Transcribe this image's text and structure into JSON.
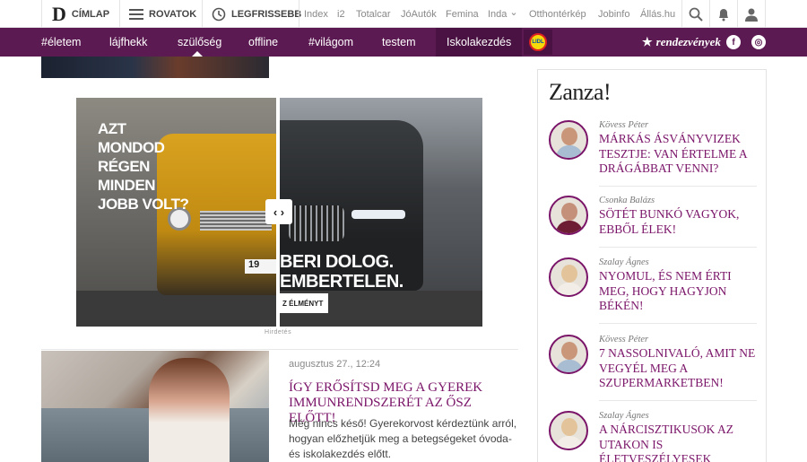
{
  "topnav": {
    "logo": "D",
    "home_label": "CÍMLAP",
    "sections_label": "ROVATOK",
    "latest_label": "LEGFRISSEBB",
    "links": [
      "Index",
      "i2",
      "Totalcar",
      "JóAutók",
      "Femina",
      "Inda",
      "Otthontérkép",
      "Jobinfo",
      "Állás.hu"
    ],
    "inda_chevron": "⌄"
  },
  "catbar": {
    "categories": [
      "#életem",
      "lájfhekk",
      "szülőség",
      "offline",
      "#világom",
      "testem",
      "Iskolakezdés"
    ],
    "sponsor_logo": "LIDL",
    "events_label": "rendezvények",
    "events_icon": "★",
    "facebook_icon": "f",
    "instagram_icon": "◎"
  },
  "ad": {
    "left_text": "AZT MONDOD RÉGEN MINDEN JOBB VOLT?",
    "right_text": "BERI DOLOG.\nEMBERTELEN.",
    "cta": "Z ÉLMÉNYT",
    "handle": "‹ ›",
    "plate": "19",
    "label": "Hirdetés"
  },
  "article": {
    "date": "augusztus 27., 12:24",
    "title": "Így erősítsd meg a gyerek immunrendszerét az ősz előtt!",
    "lead": "Még nincs késő! Gyerekorvost kérdeztünk arról, hogyan előzhetjük meg a betegségeket óvoda- és iskolakezdés előtt."
  },
  "sidebar": {
    "title": "Zanza!",
    "items": [
      {
        "author": "Kövess Péter",
        "title": "Márkás ásványvizek tesztje: van értelme a drágábbat venni?"
      },
      {
        "author": "Csonka Balázs",
        "title": "Sötét bunkó vagyok, ebből élek!"
      },
      {
        "author": "Szalay Ágnes",
        "title": "Nyomul, és nem érti meg, hogy hagyjon békén!"
      },
      {
        "author": "Kövess Péter",
        "title": "7 nassolnivaló, amit ne vegyél meg a szupermarketben!"
      },
      {
        "author": "Szalay Ágnes",
        "title": "A nárcisztikusok az utakon is életveszélyesek"
      }
    ]
  },
  "colors": {
    "brand_purple": "#5c1a52",
    "title_purple": "#7a1468"
  }
}
